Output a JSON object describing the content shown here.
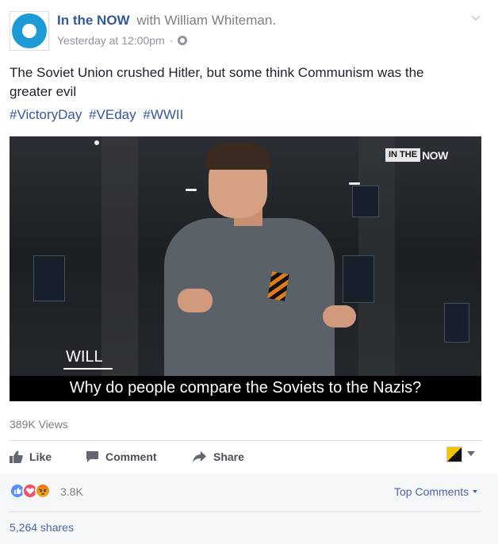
{
  "header": {
    "page_name": "In the NOW",
    "with_text": "with",
    "user_name": "William Whiteman.",
    "timestamp": "Yesterday at 12:00pm",
    "separator": "·",
    "privacy_icon": "globe-icon",
    "options_icon": "chevron-down-icon"
  },
  "post": {
    "text": "The Soviet Union crushed Hitler, but some think Communism was the greater evil",
    "hashtags": [
      "#VictoryDay",
      "#VEday",
      "#WWII"
    ]
  },
  "video": {
    "logo_part1": "IN THE",
    "logo_part2": "NOW",
    "name_tag": "WILL",
    "caption": "Why do people compare the Soviets to the Nazis?"
  },
  "stats": {
    "views": "389K Views"
  },
  "actions": {
    "like_label": "Like",
    "comment_label": "Comment",
    "share_label": "Share"
  },
  "reactions": {
    "icons": [
      "like-icon",
      "love-icon",
      "angry-icon"
    ],
    "count": "3.8K",
    "top_comments_label": "Top Comments",
    "shares": "5,264 shares"
  },
  "colors": {
    "link": "#365899",
    "meta": "#90949c",
    "accent_blue": "#1e9bd7",
    "love": "#f25268",
    "like": "#5890ff"
  }
}
